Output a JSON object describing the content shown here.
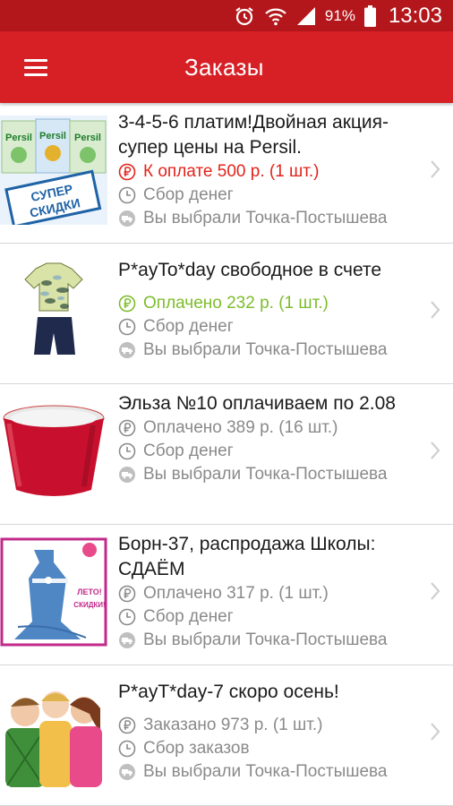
{
  "status_bar": {
    "battery_percent": "91%",
    "time": "13:03",
    "icons": [
      "alarm-icon",
      "wifi-icon",
      "signal-icon",
      "battery-icon"
    ]
  },
  "app_bar": {
    "title": "Заказы",
    "menu_icon": "hamburger-menu-icon"
  },
  "colors": {
    "status_bar": "#b3171b",
    "app_bar": "#d71f26",
    "payment_due": "#e2231a",
    "paid_accent": "#7dbd2b",
    "secondary_text": "#8a8a8a"
  },
  "orders": [
    {
      "title": "3-4-5-6 платим!Двойная акция-супер цены на Persil.",
      "payment": "К оплате 500 р. (1 шт.)",
      "payment_state": "due",
      "stage": "Сбор денег",
      "pickup": "Вы выбрали Точка-Постышева",
      "thumb_text": [
        "Persil",
        "Persil",
        "Persil",
        "СУПЕР",
        "СКИДКИ"
      ]
    },
    {
      "title": "P*ayTo*day свободное в счете",
      "payment": "Оплачено 232 р. (1 шт.)",
      "payment_state": "paid-accent",
      "stage": "Сбор денег",
      "pickup": "Вы выбрали Точка-Постышева"
    },
    {
      "title": "Эльза №10 оплачиваем по 2.08",
      "payment": "Оплачено 389 р. (16 шт.)",
      "payment_state": "paid",
      "stage": "Сбор денег",
      "pickup": "Вы выбрали Точка-Постышева"
    },
    {
      "title": "Борн-37, распродажа Школы: СДАЁМ",
      "payment": "Оплачено 317 р. (1 шт.)",
      "payment_state": "paid",
      "stage": "Сбор денег",
      "pickup": "Вы выбрали Точка-Постышева",
      "thumb_text": [
        "ЛЕТО!",
        "СКИДКИ!"
      ]
    },
    {
      "title": "P*ayT*day-7 скоро осень!",
      "payment": "Заказано 973 р. (1 шт.)",
      "payment_state": "ordered",
      "stage": "Сбор заказов",
      "pickup": "Вы выбрали Точка-Постышева"
    }
  ]
}
